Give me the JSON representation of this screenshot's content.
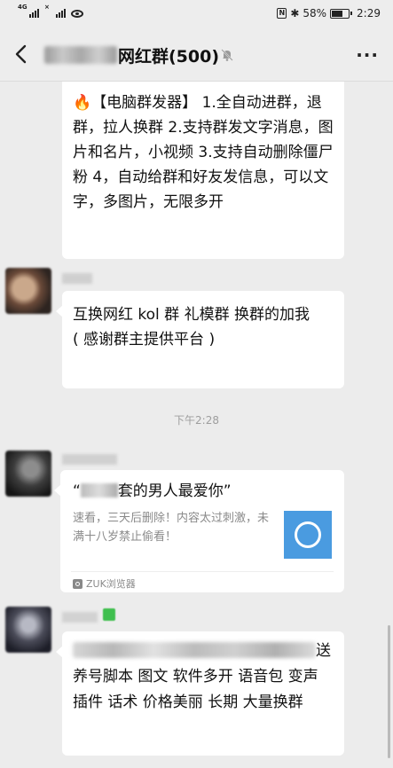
{
  "status_bar": {
    "battery": "58%",
    "time": "2:29",
    "sim1_tag": "4G",
    "sim2_tag": "×",
    "bluetooth_icon": "bluetooth-icon",
    "nfc_glyph": "N"
  },
  "header": {
    "title": "网红群(500)",
    "back_icon": "back-arrow-icon",
    "mute_icon": "mute-bell-icon",
    "more_label": "···"
  },
  "messages": {
    "first_bubble": "🔥【电脑群发器】 1.全自动进群，退群，拉人换群 2.支持群发文字消息，图片和名片，小视频 3.支持自动删除僵尸粉 4，自动给群和好友发信息，可以文字，多图片，无限多开",
    "second_bubble_line1": "互换网红 kol 群 礼模群 换群的加我",
    "second_bubble_line2": "( 感谢群主提供平台 )",
    "timestamp": "下午2:28",
    "card": {
      "title_prefix": "“",
      "title_suffix": "套的男人最爱你”",
      "description": "速看，三天后删除！内容太过刺激，未满十八岁禁止偷看！",
      "source": "ZUK浏览器"
    },
    "last_bubble_tail": "送",
    "last_bubble_body": "养号脚本 图文 软件多开 语音包 变声 插件 话术  价格美丽   长期 大量换群"
  },
  "colors": {
    "background": "#ececec",
    "bubble": "#ffffff",
    "card_thumb": "#4a9be0"
  }
}
